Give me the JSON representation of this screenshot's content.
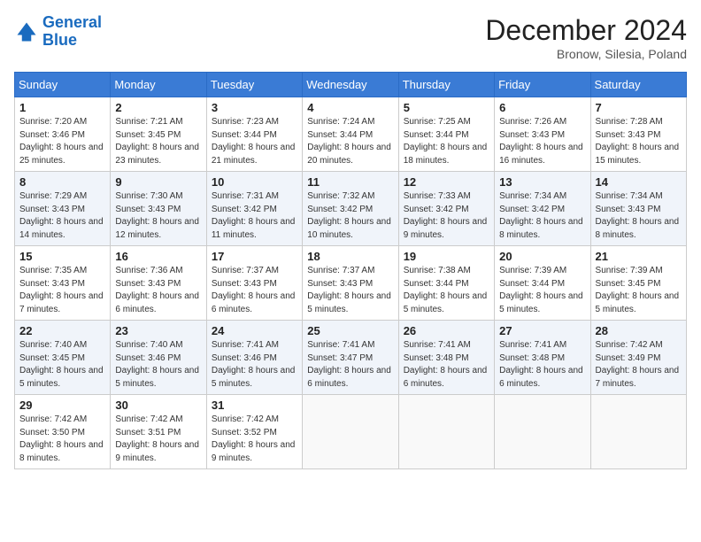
{
  "header": {
    "logo_line1": "General",
    "logo_line2": "Blue",
    "month": "December 2024",
    "location": "Bronow, Silesia, Poland"
  },
  "days_of_week": [
    "Sunday",
    "Monday",
    "Tuesday",
    "Wednesday",
    "Thursday",
    "Friday",
    "Saturday"
  ],
  "weeks": [
    [
      {
        "day": 1,
        "sunrise": "7:20 AM",
        "sunset": "3:46 PM",
        "daylight": "8 hours and 25 minutes."
      },
      {
        "day": 2,
        "sunrise": "7:21 AM",
        "sunset": "3:45 PM",
        "daylight": "8 hours and 23 minutes."
      },
      {
        "day": 3,
        "sunrise": "7:23 AM",
        "sunset": "3:44 PM",
        "daylight": "8 hours and 21 minutes."
      },
      {
        "day": 4,
        "sunrise": "7:24 AM",
        "sunset": "3:44 PM",
        "daylight": "8 hours and 20 minutes."
      },
      {
        "day": 5,
        "sunrise": "7:25 AM",
        "sunset": "3:44 PM",
        "daylight": "8 hours and 18 minutes."
      },
      {
        "day": 6,
        "sunrise": "7:26 AM",
        "sunset": "3:43 PM",
        "daylight": "8 hours and 16 minutes."
      },
      {
        "day": 7,
        "sunrise": "7:28 AM",
        "sunset": "3:43 PM",
        "daylight": "8 hours and 15 minutes."
      }
    ],
    [
      {
        "day": 8,
        "sunrise": "7:29 AM",
        "sunset": "3:43 PM",
        "daylight": "8 hours and 14 minutes."
      },
      {
        "day": 9,
        "sunrise": "7:30 AM",
        "sunset": "3:43 PM",
        "daylight": "8 hours and 12 minutes."
      },
      {
        "day": 10,
        "sunrise": "7:31 AM",
        "sunset": "3:42 PM",
        "daylight": "8 hours and 11 minutes."
      },
      {
        "day": 11,
        "sunrise": "7:32 AM",
        "sunset": "3:42 PM",
        "daylight": "8 hours and 10 minutes."
      },
      {
        "day": 12,
        "sunrise": "7:33 AM",
        "sunset": "3:42 PM",
        "daylight": "8 hours and 9 minutes."
      },
      {
        "day": 13,
        "sunrise": "7:34 AM",
        "sunset": "3:42 PM",
        "daylight": "8 hours and 8 minutes."
      },
      {
        "day": 14,
        "sunrise": "7:34 AM",
        "sunset": "3:43 PM",
        "daylight": "8 hours and 8 minutes."
      }
    ],
    [
      {
        "day": 15,
        "sunrise": "7:35 AM",
        "sunset": "3:43 PM",
        "daylight": "8 hours and 7 minutes."
      },
      {
        "day": 16,
        "sunrise": "7:36 AM",
        "sunset": "3:43 PM",
        "daylight": "8 hours and 6 minutes."
      },
      {
        "day": 17,
        "sunrise": "7:37 AM",
        "sunset": "3:43 PM",
        "daylight": "8 hours and 6 minutes."
      },
      {
        "day": 18,
        "sunrise": "7:37 AM",
        "sunset": "3:43 PM",
        "daylight": "8 hours and 5 minutes."
      },
      {
        "day": 19,
        "sunrise": "7:38 AM",
        "sunset": "3:44 PM",
        "daylight": "8 hours and 5 minutes."
      },
      {
        "day": 20,
        "sunrise": "7:39 AM",
        "sunset": "3:44 PM",
        "daylight": "8 hours and 5 minutes."
      },
      {
        "day": 21,
        "sunrise": "7:39 AM",
        "sunset": "3:45 PM",
        "daylight": "8 hours and 5 minutes."
      }
    ],
    [
      {
        "day": 22,
        "sunrise": "7:40 AM",
        "sunset": "3:45 PM",
        "daylight": "8 hours and 5 minutes."
      },
      {
        "day": 23,
        "sunrise": "7:40 AM",
        "sunset": "3:46 PM",
        "daylight": "8 hours and 5 minutes."
      },
      {
        "day": 24,
        "sunrise": "7:41 AM",
        "sunset": "3:46 PM",
        "daylight": "8 hours and 5 minutes."
      },
      {
        "day": 25,
        "sunrise": "7:41 AM",
        "sunset": "3:47 PM",
        "daylight": "8 hours and 6 minutes."
      },
      {
        "day": 26,
        "sunrise": "7:41 AM",
        "sunset": "3:48 PM",
        "daylight": "8 hours and 6 minutes."
      },
      {
        "day": 27,
        "sunrise": "7:41 AM",
        "sunset": "3:48 PM",
        "daylight": "8 hours and 6 minutes."
      },
      {
        "day": 28,
        "sunrise": "7:42 AM",
        "sunset": "3:49 PM",
        "daylight": "8 hours and 7 minutes."
      }
    ],
    [
      {
        "day": 29,
        "sunrise": "7:42 AM",
        "sunset": "3:50 PM",
        "daylight": "8 hours and 8 minutes."
      },
      {
        "day": 30,
        "sunrise": "7:42 AM",
        "sunset": "3:51 PM",
        "daylight": "8 hours and 9 minutes."
      },
      {
        "day": 31,
        "sunrise": "7:42 AM",
        "sunset": "3:52 PM",
        "daylight": "8 hours and 9 minutes."
      },
      null,
      null,
      null,
      null
    ]
  ]
}
